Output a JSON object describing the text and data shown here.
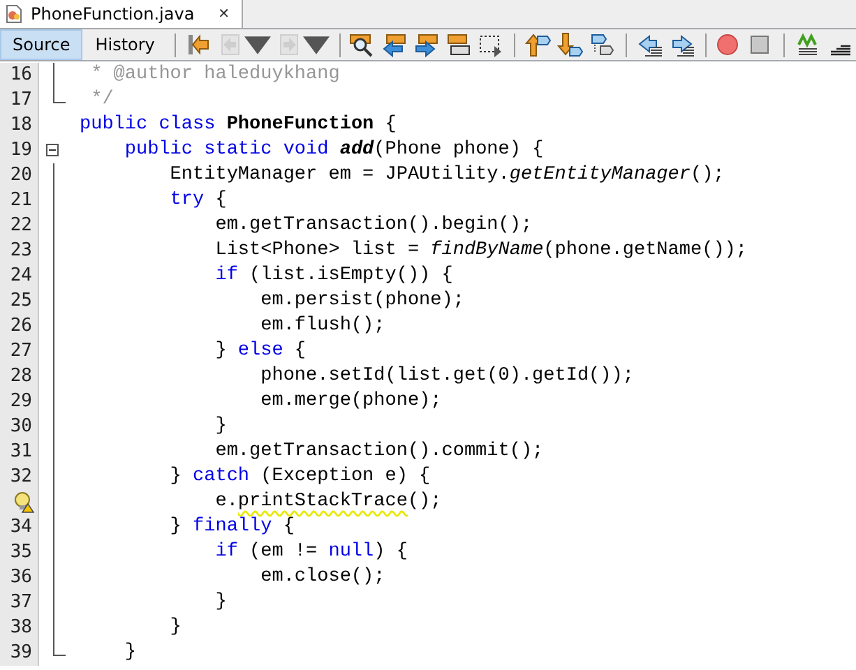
{
  "file_tab": {
    "title": "PhoneFunction.java",
    "close": "✕",
    "selected": true
  },
  "view_tabs": [
    {
      "label": "Source",
      "selected": true
    },
    {
      "label": "History",
      "selected": false
    }
  ],
  "toolbar": [
    {
      "kind": "separator"
    },
    {
      "kind": "button",
      "disabled": false
    },
    {
      "kind": "menu-button",
      "disabled": true
    },
    {
      "kind": "menu-button",
      "disabled": true
    },
    {
      "kind": "separator"
    },
    {
      "kind": "button",
      "disabled": false
    },
    {
      "kind": "button",
      "disabled": false
    },
    {
      "kind": "button",
      "disabled": false
    },
    {
      "kind": "button",
      "disabled": false
    },
    {
      "kind": "button",
      "disabled": false
    },
    {
      "kind": "separator"
    },
    {
      "kind": "button",
      "disabled": false
    },
    {
      "kind": "button",
      "disabled": false
    },
    {
      "kind": "button",
      "disabled": false
    },
    {
      "kind": "separator"
    },
    {
      "kind": "button",
      "disabled": false
    },
    {
      "kind": "button",
      "disabled": false
    },
    {
      "kind": "separator"
    },
    {
      "kind": "button",
      "disabled": false
    },
    {
      "kind": "button",
      "disabled": false
    },
    {
      "kind": "separator"
    },
    {
      "kind": "button",
      "disabled": false
    },
    {
      "kind": "button",
      "disabled": false
    }
  ],
  "lines": [
    {
      "number": "16",
      "kind": "fold-line",
      "tokens": [
        {
          "kind": "comment",
          "t": " * @author haleduykhang"
        }
      ]
    },
    {
      "number": "17",
      "kind": "fold-end",
      "tokens": [
        {
          "kind": "comment",
          "t": " */"
        }
      ]
    },
    {
      "number": "18",
      "kind": "plain",
      "tokens": [
        {
          "kind": "keyword",
          "t": "public class "
        },
        {
          "kind": "type-name",
          "t": "PhoneFunction"
        },
        {
          "kind": "text",
          "t": " {"
        }
      ]
    },
    {
      "number": "19",
      "kind": "fold-toggle",
      "tokens": [
        {
          "kind": "keyword",
          "t": "    public static void "
        },
        {
          "kind": "method-name",
          "t": "add"
        },
        {
          "kind": "text",
          "t": "(Phone phone) {"
        }
      ]
    },
    {
      "number": "20",
      "kind": "fold-line",
      "tokens": [
        {
          "kind": "text",
          "t": "        EntityManager em = JPAUtility."
        },
        {
          "kind": "static-call",
          "t": "getEntityManager"
        },
        {
          "kind": "text",
          "t": "();"
        }
      ]
    },
    {
      "number": "21",
      "kind": "fold-line",
      "tokens": [
        {
          "kind": "keyword",
          "t": "        try"
        },
        {
          "kind": "text",
          "t": " {"
        }
      ]
    },
    {
      "number": "22",
      "kind": "fold-line",
      "tokens": [
        {
          "kind": "text",
          "t": "            em.getTransaction().begin();"
        }
      ]
    },
    {
      "number": "23",
      "kind": "fold-line",
      "tokens": [
        {
          "kind": "text",
          "t": "            List<Phone> list = "
        },
        {
          "kind": "static-call",
          "t": "findByName"
        },
        {
          "kind": "text",
          "t": "(phone.getName());"
        }
      ]
    },
    {
      "number": "24",
      "kind": "fold-line",
      "tokens": [
        {
          "kind": "keyword",
          "t": "            if"
        },
        {
          "kind": "text",
          "t": " (list.isEmpty()) {"
        }
      ]
    },
    {
      "number": "25",
      "kind": "fold-line",
      "tokens": [
        {
          "kind": "text",
          "t": "                em.persist(phone);"
        }
      ]
    },
    {
      "number": "26",
      "kind": "fold-line",
      "tokens": [
        {
          "kind": "text",
          "t": "                em.flush();"
        }
      ]
    },
    {
      "number": "27",
      "kind": "fold-line",
      "tokens": [
        {
          "kind": "text",
          "t": "            } "
        },
        {
          "kind": "keyword",
          "t": "else"
        },
        {
          "kind": "text",
          "t": " {"
        }
      ]
    },
    {
      "number": "28",
      "kind": "fold-line",
      "tokens": [
        {
          "kind": "text",
          "t": "                phone.setId(list.get(0).getId());"
        }
      ]
    },
    {
      "number": "29",
      "kind": "fold-line",
      "tokens": [
        {
          "kind": "text",
          "t": "                em.merge(phone);"
        }
      ]
    },
    {
      "number": "30",
      "kind": "fold-line",
      "tokens": [
        {
          "kind": "text",
          "t": "            }"
        }
      ]
    },
    {
      "number": "31",
      "kind": "fold-line",
      "tokens": [
        {
          "kind": "text",
          "t": "            em.getTransaction().commit();"
        }
      ]
    },
    {
      "number": "32",
      "kind": "fold-line",
      "tokens": [
        {
          "kind": "text",
          "t": "        } "
        },
        {
          "kind": "keyword",
          "t": "catch"
        },
        {
          "kind": "text",
          "t": " (Exception e) {"
        }
      ]
    },
    {
      "hint": true,
      "kind": "fold-line",
      "tokens": [
        {
          "kind": "text",
          "t": "            e."
        },
        {
          "kind": "warning",
          "t": "printStackTrace"
        },
        {
          "kind": "text",
          "t": "();"
        }
      ]
    },
    {
      "number": "34",
      "kind": "fold-line",
      "tokens": [
        {
          "kind": "text",
          "t": "        } "
        },
        {
          "kind": "keyword",
          "t": "finally"
        },
        {
          "kind": "text",
          "t": " {"
        }
      ]
    },
    {
      "number": "35",
      "kind": "fold-line",
      "tokens": [
        {
          "kind": "keyword",
          "t": "            if"
        },
        {
          "kind": "text",
          "t": " (em != "
        },
        {
          "kind": "keyword",
          "t": "null"
        },
        {
          "kind": "text",
          "t": ") {"
        }
      ]
    },
    {
      "number": "36",
      "kind": "fold-line",
      "tokens": [
        {
          "kind": "text",
          "t": "                em.close();"
        }
      ]
    },
    {
      "number": "37",
      "kind": "fold-line",
      "tokens": [
        {
          "kind": "text",
          "t": "            }"
        }
      ]
    },
    {
      "number": "38",
      "kind": "fold-line",
      "tokens": [
        {
          "kind": "text",
          "t": "        }"
        }
      ]
    },
    {
      "number": "39",
      "kind": "fold-end",
      "tokens": [
        {
          "kind": "text",
          "t": "    }"
        }
      ]
    }
  ]
}
